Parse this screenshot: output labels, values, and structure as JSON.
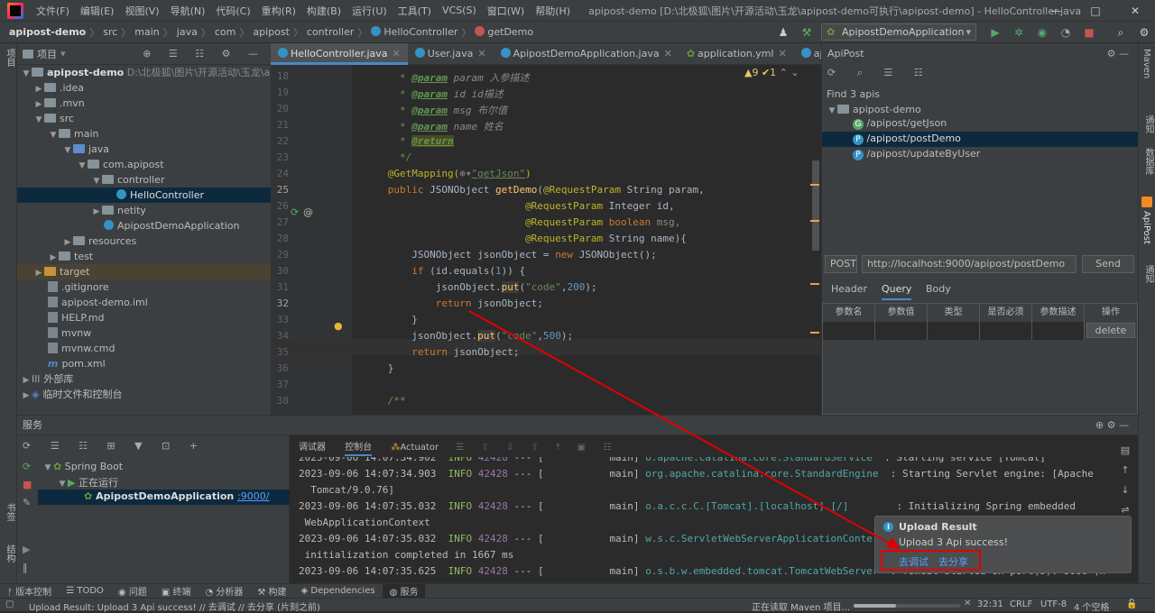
{
  "app": {
    "menu": [
      "文件(F)",
      "编辑(E)",
      "视图(V)",
      "导航(N)",
      "代码(C)",
      "重构(R)",
      "构建(B)",
      "运行(U)",
      "工具(T)",
      "VCS(S)",
      "窗口(W)",
      "帮助(H)"
    ],
    "window_title": "apipost-demo [D:\\北极狐\\图片\\开源活动\\玉龙\\apipost-demo可执行\\apipost-demo] - HelloController.java",
    "win_min": "—",
    "win_max": "□",
    "win_close": "✕"
  },
  "breadcrumb": {
    "items": [
      "apipost-demo",
      "src",
      "main",
      "java",
      "com",
      "apipost",
      "controller",
      "HelloController",
      "getDemo"
    ],
    "run_config": "ApipostDemoApplication"
  },
  "project": {
    "title": "项目",
    "root": "apipost-demo",
    "root_path": "D:\\北极狐\\图片\\开源活动\\玉龙\\apipo",
    "rows": [
      {
        "label": ".idea"
      },
      {
        "label": ".mvn"
      },
      {
        "label": "src"
      },
      {
        "label": "main"
      },
      {
        "label": "java"
      },
      {
        "label": "com.apipost"
      },
      {
        "label": "controller"
      },
      {
        "label": "HelloController"
      },
      {
        "label": "netity"
      },
      {
        "label": "ApipostDemoApplication"
      },
      {
        "label": "resources"
      },
      {
        "label": "test"
      },
      {
        "label": "target"
      },
      {
        "label": ".gitignore"
      },
      {
        "label": "apipost-demo.iml"
      },
      {
        "label": "HELP.md"
      },
      {
        "label": "mvnw"
      },
      {
        "label": "mvnw.cmd"
      },
      {
        "label": "pom.xml"
      },
      {
        "label": "外部库"
      },
      {
        "label": "临时文件和控制台"
      }
    ]
  },
  "editor": {
    "tabs": [
      "HelloController.java",
      "User.java",
      "ApipostDemoApplication.java",
      "application.yml",
      "aj"
    ],
    "inspection": "▲9 ✔1",
    "line_numbers": [
      "18",
      "19",
      "20",
      "21",
      "22",
      "23",
      "24",
      "25",
      "26",
      "27",
      "28",
      "29",
      "30",
      "31",
      "32",
      "33",
      "34",
      "35",
      "36",
      "37",
      "38"
    ],
    "lines": {
      "l18a": " * ",
      "l18b": "@param",
      "l18c": " param 入参描述",
      "l19a": " * ",
      "l19b": "@param",
      "l19c": " id id描述",
      "l20a": " * ",
      "l20b": "@param",
      "l20c": " msg 布尔值",
      "l21a": " * ",
      "l21b": "@param",
      "l21c": " name 姓名",
      "l22a": " * ",
      "l22b": "@return",
      "l23": " */",
      "l24a": "@GetMapping(",
      "l24b": "\"getJson\"",
      "l24c": ")",
      "l25a": "public ",
      "l25b": "JSONObject ",
      "l25c": "getDemo",
      "l25d": "(",
      "l25e": "@RequestParam ",
      "l25f": "String param,",
      "l26a": "@RequestParam ",
      "l26b": "Integer id,",
      "l27a": "@RequestParam ",
      "l27b": "boolean ",
      "l27c": "msg,",
      "l28a": "@RequestParam ",
      "l28b": "String name){",
      "l29a": "JSONObject jsonObject = ",
      "l29b": "new ",
      "l29c": "JSONObject();",
      "l30a": "if ",
      "l30b": "(id.equals(",
      "l30c": "1",
      "l30d": ")) {",
      "l31a": "jsonObject.",
      "l31b": "put",
      "l31c": "(",
      "l31d": "\"code\"",
      "l31e": ",",
      "l31f": "200",
      "l31g": ");",
      "l32a": "return ",
      "l32b": "jsonObject;",
      "l33": "}",
      "l34a": "jsonObject.",
      "l34b": "put",
      "l34c": "(",
      "l34d": "\"code\"",
      "l34e": ",",
      "l34f": "500",
      "l34g": ");",
      "l35a": "return ",
      "l35b": "jsonObject;",
      "l36": "}",
      "l38": "/**"
    }
  },
  "apipost": {
    "title": "ApiPost",
    "found": "Find 3 apis",
    "project": "apipost-demo",
    "apis": [
      {
        "method": "G",
        "path": "/apipost/getJson"
      },
      {
        "method": "P",
        "path": "/apipost/postDemo"
      },
      {
        "method": "P",
        "path": "/apipost/updateByUser"
      }
    ],
    "http_method": "POST",
    "url": "http://localhost:9000/apipost/postDemo",
    "send": "Send",
    "param_tabs": [
      "Header",
      "Query",
      "Body"
    ],
    "table_headers": [
      "参数名",
      "参数值",
      "类型",
      "是否必须",
      "参数描述",
      "操作"
    ],
    "delete": "delete"
  },
  "services": {
    "title": "服务",
    "tree": [
      "Spring Boot",
      "正在运行",
      "ApipostDemoApplication",
      ":9000/"
    ],
    "console_tabs": [
      "调试器",
      "控制台",
      "Actuator"
    ],
    "log": [
      {
        "time": "2023-09-06 14:07:34.902",
        "level": "INFO",
        "pid": "42428",
        "sep": "--- [",
        "thread": "main]",
        "logger": "o.apache.catalina.core.StandardService",
        "msg": ": Starting service [Tomcat]"
      },
      {
        "time": "2023-09-06 14:07:34.903",
        "level": "INFO",
        "pid": "42428",
        "sep": "--- [",
        "thread": "main]",
        "logger": "org.apache.catalina.core.StandardEngine",
        "msg": ": Starting Servlet engine: [Apache",
        "cont": "Tomcat/9.0.76]"
      },
      {
        "time": "2023-09-06 14:07:35.032",
        "level": "INFO",
        "pid": "42428",
        "sep": "--- [",
        "thread": "main]",
        "logger": "o.a.c.c.C.[Tomcat].[localhost].[/]",
        "msg": ": Initializing Spring embedded",
        "cont": "WebApplicationContext"
      },
      {
        "time": "2023-09-06 14:07:35.032",
        "level": "INFO",
        "pid": "42428",
        "sep": "--- [",
        "thread": "main]",
        "logger": "w.s.c.ServletWebServerApplicationConte",
        "msg": "",
        "cont": "initialization completed in 1667 ms"
      },
      {
        "time": "2023-09-06 14:07:35.625",
        "level": "INFO",
        "pid": "42428",
        "sep": "--- [",
        "thread": "main]",
        "logger": "o.s.b.w.embedded.tomcat.TomcatWebServer",
        "msg": ": Tomcat started on port(s): 9000 (h"
      }
    ]
  },
  "notification": {
    "title": "Upload Result",
    "body": "Upload 3 Api success!",
    "action1": "去调试",
    "action2": "去分享"
  },
  "toolwindows": [
    "版本控制",
    "TODO",
    "问题",
    "终端",
    "分析器",
    "构建",
    "Dependencies",
    "服务"
  ],
  "status": {
    "message": "Upload Result: Upload 3 Api success! // 去调试 // 去分享 (片刻之前)",
    "progress_text": "正在读取 Maven 项目...",
    "position": "32:31",
    "line_sep": "CRLF",
    "encoding": "UTF-8",
    "ctx": "4 个空格"
  },
  "side_labels": {
    "left_top": "项目",
    "left_mid": "书签",
    "left_bot": "结构",
    "right1": "Maven",
    "right2": "通知",
    "right3": "数据库",
    "right4": "ApiPost",
    "right5": "通知"
  },
  "colors": {
    "accent": "#4a88c7",
    "highlight_border": "#e00000",
    "arrow": "#e00000"
  }
}
